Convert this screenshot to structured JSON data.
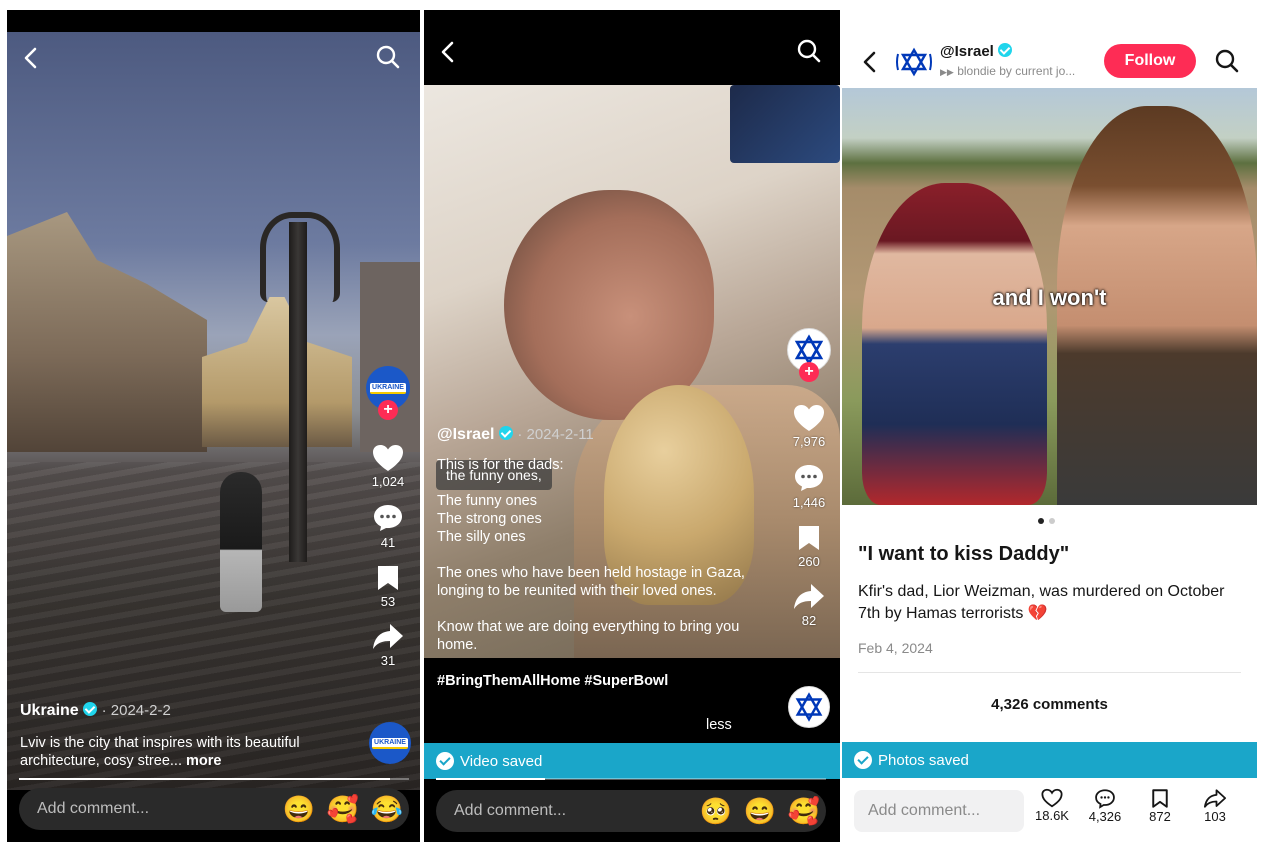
{
  "panel1": {
    "author": "Ukraine",
    "date": "· 2024-2-2",
    "caption": "Lviv is the city that inspires with its beautiful architecture, cosy stree...",
    "more_label": "more",
    "avatar_tag": "UKRAINE",
    "likes": "1,024",
    "comments": "41",
    "saves": "53",
    "shares": "31",
    "comment_placeholder": "Add comment...",
    "emojis": [
      "😄",
      "🥰",
      "😂"
    ],
    "progress": 0.95
  },
  "panel2": {
    "caption_chip": "the funny ones,",
    "author": "@Israel",
    "date": "· 2024-2-11",
    "caption_lines": [
      "This is for the dads:",
      "",
      "The funny ones",
      "The strong ones",
      "The silly ones",
      "",
      "The ones who have been held hostage in Gaza, longing to be reunited with their loved ones.",
      "",
      "Know that we are doing everything to bring you home.",
      "",
      "#BringThemAllHome #SuperBowl"
    ],
    "less_label": "less",
    "likes": "7,976",
    "comments": "1,446",
    "saves": "260",
    "shares": "82",
    "saved_banner": "Video saved",
    "comment_placeholder": "Add comment...",
    "emojis": [
      "🥺",
      "😄",
      "🥰"
    ],
    "progress": 0.28
  },
  "panel3": {
    "author": "@Israel",
    "music": "blondie by current jo...",
    "follow_label": "Follow",
    "overlay_text": "and I won't",
    "title": "\"I want to kiss Daddy\"",
    "body": "Kfir's dad, Lior Weizman, was murdered on October 7th by Hamas terrorists 💔",
    "date": "Feb 4, 2024",
    "comments_header": "4,326 comments",
    "saved_banner": "Photos saved",
    "comment_placeholder": "Add comment...",
    "likes": "18.6K",
    "comments": "4,326",
    "saves": "872",
    "shares": "103"
  },
  "colors": {
    "follow": "#fe2c55",
    "saved_banner": "#1aa6c9",
    "verified": "#20d5ec",
    "israel_blue": "#0038b8"
  }
}
